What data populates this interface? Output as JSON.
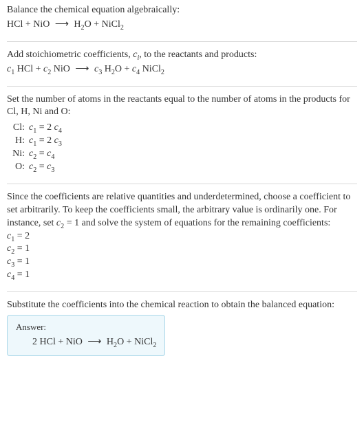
{
  "sec1": {
    "intro": "Balance the chemical equation algebraically:",
    "eq_html": "HCl + NiO <span class='arrow'>⟶</span> H<span class='sub'>2</span>O + NiCl<span class='sub'>2</span>"
  },
  "sec2": {
    "intro_html": "Add stoichiometric coefficients, <span class='it'>c<span class='sub'>i</span></span>, to the reactants and products:",
    "eq_html": "<span class='it'>c</span><span class='sub'>1</span> HCl + <span class='it'>c</span><span class='sub'>2</span> NiO <span class='arrow'>⟶</span> <span class='it'>c</span><span class='sub'>3</span> H<span class='sub'>2</span>O + <span class='it'>c</span><span class='sub'>4</span> NiCl<span class='sub'>2</span>"
  },
  "sec3": {
    "intro": "Set the number of atoms in the reactants equal to the number of atoms in the products for Cl, H, Ni and O:",
    "rows": [
      {
        "lbl": "Cl:",
        "eq_html": "<span class='it'>c</span><span class='sub'>1</span> = 2 <span class='it'>c</span><span class='sub'>4</span>"
      },
      {
        "lbl": "H:",
        "eq_html": "<span class='it'>c</span><span class='sub'>1</span> = 2 <span class='it'>c</span><span class='sub'>3</span>"
      },
      {
        "lbl": "Ni:",
        "eq_html": "<span class='it'>c</span><span class='sub'>2</span> = <span class='it'>c</span><span class='sub'>4</span>"
      },
      {
        "lbl": "O:",
        "eq_html": "<span class='it'>c</span><span class='sub'>2</span> = <span class='it'>c</span><span class='sub'>3</span>"
      }
    ]
  },
  "sec4": {
    "intro_html": "Since the coefficients are relative quantities and underdetermined, choose a coefficient to set arbitrarily. To keep the coefficients small, the arbitrary value is ordinarily one. For instance, set <span class='it'>c</span><span class='sub'>2</span> = 1 and solve the system of equations for the remaining coefficients:",
    "solutions": [
      "<span class='it'>c</span><span class='sub'>1</span> = 2",
      "<span class='it'>c</span><span class='sub'>2</span> = 1",
      "<span class='it'>c</span><span class='sub'>3</span> = 1",
      "<span class='it'>c</span><span class='sub'>4</span> = 1"
    ]
  },
  "sec5": {
    "intro": "Substitute the coefficients into the chemical reaction to obtain the balanced equation:",
    "answer_label": "Answer:",
    "answer_eq_html": "2 HCl + NiO <span class='arrow'>⟶</span> H<span class='sub'>2</span>O + NiCl<span class='sub'>2</span>"
  }
}
